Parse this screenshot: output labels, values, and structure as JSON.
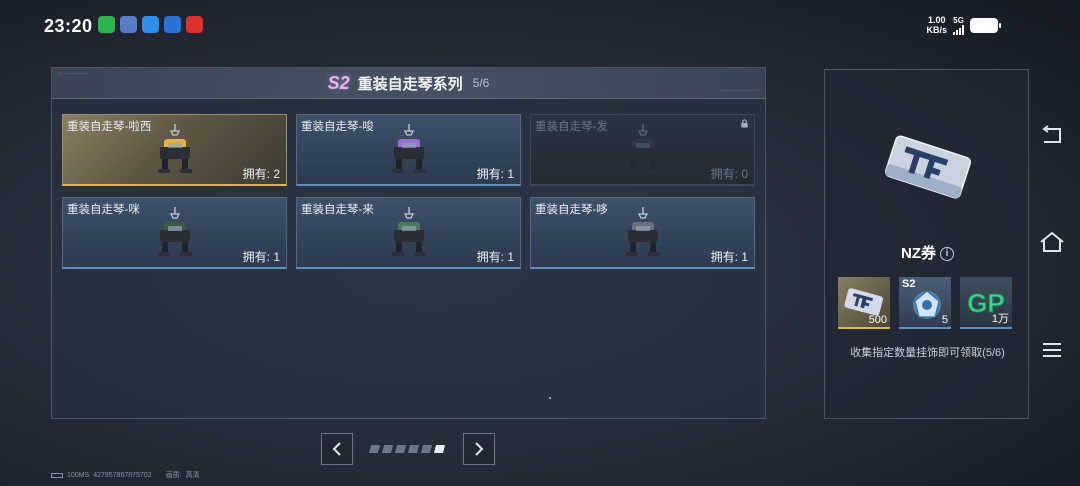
{
  "status_bar": {
    "time": "23:20",
    "net_speed_value": "1.00",
    "net_speed_unit": "KB/s",
    "network_type": "5G"
  },
  "collection": {
    "season_badge": "S2",
    "title": "重装自走琴系列",
    "progress": "5/6",
    "items": [
      {
        "name": "重装自走琴-啦西",
        "owned": "拥有: 2",
        "state": "highlighted",
        "accent": "#e2b24e"
      },
      {
        "name": "重装自走琴-唆",
        "owned": "拥有: 1",
        "state": "owned",
        "accent": "#9b6fd6"
      },
      {
        "name": "重装自走琴-发",
        "owned": "拥有: 0",
        "state": "locked",
        "accent": "#3d4756"
      },
      {
        "name": "重装自走琴-咪",
        "owned": "拥有: 1",
        "state": "owned",
        "accent": "#3c5a48"
      },
      {
        "name": "重装自走琴-来",
        "owned": "拥有: 1",
        "state": "owned",
        "accent": "#4a7a5c"
      },
      {
        "name": "重装自走琴-哆",
        "owned": "拥有: 1",
        "state": "owned",
        "accent": "#6b6f7e"
      }
    ]
  },
  "pager": {
    "prev_icon": "chevron-left-icon",
    "next_icon": "chevron-right-icon",
    "page_count": 6,
    "active_page": 6
  },
  "reward": {
    "name": "NZ券",
    "info_label": "i",
    "items": [
      {
        "icon": "nz-ticket-icon",
        "tag": "",
        "count": "500"
      },
      {
        "icon": "s2-crystal-icon",
        "tag": "S2",
        "count": "5"
      },
      {
        "icon": "gp-icon",
        "tag": "",
        "count": "1万"
      }
    ],
    "description": "收集指定数量挂饰即可领取(5/6)"
  },
  "side_nav": [
    "back-icon",
    "home-icon",
    "menu-icon"
  ],
  "footer": {
    "ping": "100MS",
    "player_id": "427957867875702",
    "quality_label": "画质:",
    "quality_value": "高清"
  },
  "colors": {
    "gold_accent": "#e2b24e",
    "blue_accent": "#5e8fbf",
    "season_pink": "#e7b8ee"
  }
}
